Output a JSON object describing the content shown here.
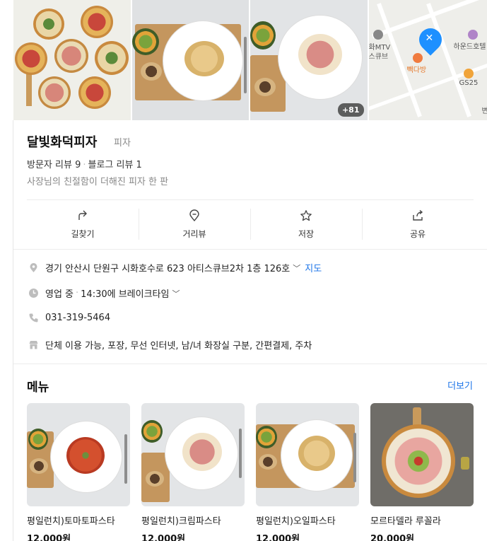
{
  "photos": {
    "more_count": "+81"
  },
  "map": {
    "labels": [
      "화MTV",
      "스큐브",
      "하운드호텔",
      "빽다방",
      "GS25",
      "변"
    ]
  },
  "place": {
    "name": "달빛화덕피자",
    "category": "피자",
    "visitor_reviews": "방문자 리뷰 9",
    "blog_reviews": "블로그 리뷰 1",
    "description": "사장님의 친절함이 더해진 피자 한 판"
  },
  "actions": [
    {
      "label": "길찾기",
      "icon": "directions-icon"
    },
    {
      "label": "거리뷰",
      "icon": "street-view-icon"
    },
    {
      "label": "저장",
      "icon": "star-icon"
    },
    {
      "label": "공유",
      "icon": "share-icon"
    }
  ],
  "info": {
    "address": "경기 안산시 단원구 시화호수로 623 아티스큐브2차 1층 126호",
    "map_link": "지도",
    "status": "영업 중",
    "break_time": "14:30에 브레이크타임",
    "phone": "031-319-5464",
    "amenities": "단체 이용 가능, 포장, 무선 인터넷, 남/녀 화장실 구분, 간편결제, 주차"
  },
  "menu": {
    "title": "메뉴",
    "more": "더보기",
    "items": [
      {
        "name": "평일런치)토마토파스타",
        "price": "12,000원"
      },
      {
        "name": "평일런치)크림파스타",
        "price": "12,000원"
      },
      {
        "name": "평일런치)오일파스타",
        "price": "12,000원"
      },
      {
        "name": "모르타델라 루꼴라",
        "price": "20,000원"
      }
    ]
  },
  "colors": {
    "accent": "#1a73e8",
    "pin": "#1e90ff"
  }
}
